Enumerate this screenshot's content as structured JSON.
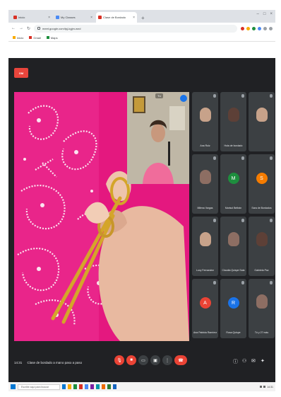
{
  "browser": {
    "tabs": [
      {
        "title": "Inicio",
        "favicon": "red-square-icon",
        "active": false
      },
      {
        "title": "My Classes",
        "favicon": "blue-square-icon",
        "active": false
      },
      {
        "title": "Clase de Bordado",
        "favicon": "red-square-icon",
        "active": true
      }
    ],
    "new_tab_symbol": "+",
    "window_controls": [
      "–",
      "□",
      "×"
    ],
    "url": "meet.google.com/tpj-kgjm-wnd",
    "bookmarks": [
      {
        "label": "Inicio",
        "icon": "folder-icon"
      },
      {
        "label": "Gmail",
        "icon": "gmail-icon"
      },
      {
        "label": "Maps",
        "icon": "maps-icon"
      }
    ]
  },
  "meeting": {
    "app_logo": "GM",
    "pip_label": "Tú",
    "participants": [
      {
        "name": "Ana Ruiz",
        "kind": "video",
        "tone": "light"
      },
      {
        "name": "Hola de bordado",
        "kind": "video",
        "tone": "dark"
      },
      {
        "name": "",
        "kind": "video",
        "tone": "light"
      },
      {
        "name": "Milena Vargas",
        "kind": "video",
        "tone": "medium"
      },
      {
        "name": "Marisol Beltrán",
        "kind": "avatar",
        "avatar_color": "#1e8e3e",
        "avatar_letter": "M"
      },
      {
        "name": "Sara de Bordados",
        "kind": "avatar",
        "avatar_color": "#f57c00",
        "avatar_letter": "S"
      },
      {
        "name": "Lucy Fernandez",
        "kind": "video",
        "tone": "light"
      },
      {
        "name": "Claudia Quispe Sala",
        "kind": "video",
        "tone": "medium"
      },
      {
        "name": "Gabriela Paz",
        "kind": "video",
        "tone": "dark"
      },
      {
        "name": "Ana Patricia Ramírez",
        "kind": "avatar",
        "avatar_color": "#ea4335",
        "avatar_letter": "A"
      },
      {
        "name": "Rosa Quispe",
        "kind": "avatar",
        "avatar_color": "#1a73e8",
        "avatar_letter": "R"
      },
      {
        "name": "Tú y 27 más",
        "kind": "more",
        "tone": "medium"
      }
    ],
    "bottom": {
      "time": "14:31",
      "title": "Clase de bordado a mano paso a paso",
      "controls": [
        "microphone-off-icon",
        "camera-off-icon",
        "captions-icon",
        "present-icon",
        "more-icon",
        "end-call-icon"
      ],
      "right_controls": [
        "info-icon",
        "people-icon",
        "chat-icon",
        "activities-icon"
      ]
    }
  },
  "taskbar": {
    "search_placeholder": "Escribe aquí para buscar",
    "clock": "14:31"
  },
  "colors": {
    "app_bg": "#202124",
    "tile_bg": "#3c4043",
    "accent_red": "#ea4335",
    "fabric_pink": "#e91e8a"
  }
}
